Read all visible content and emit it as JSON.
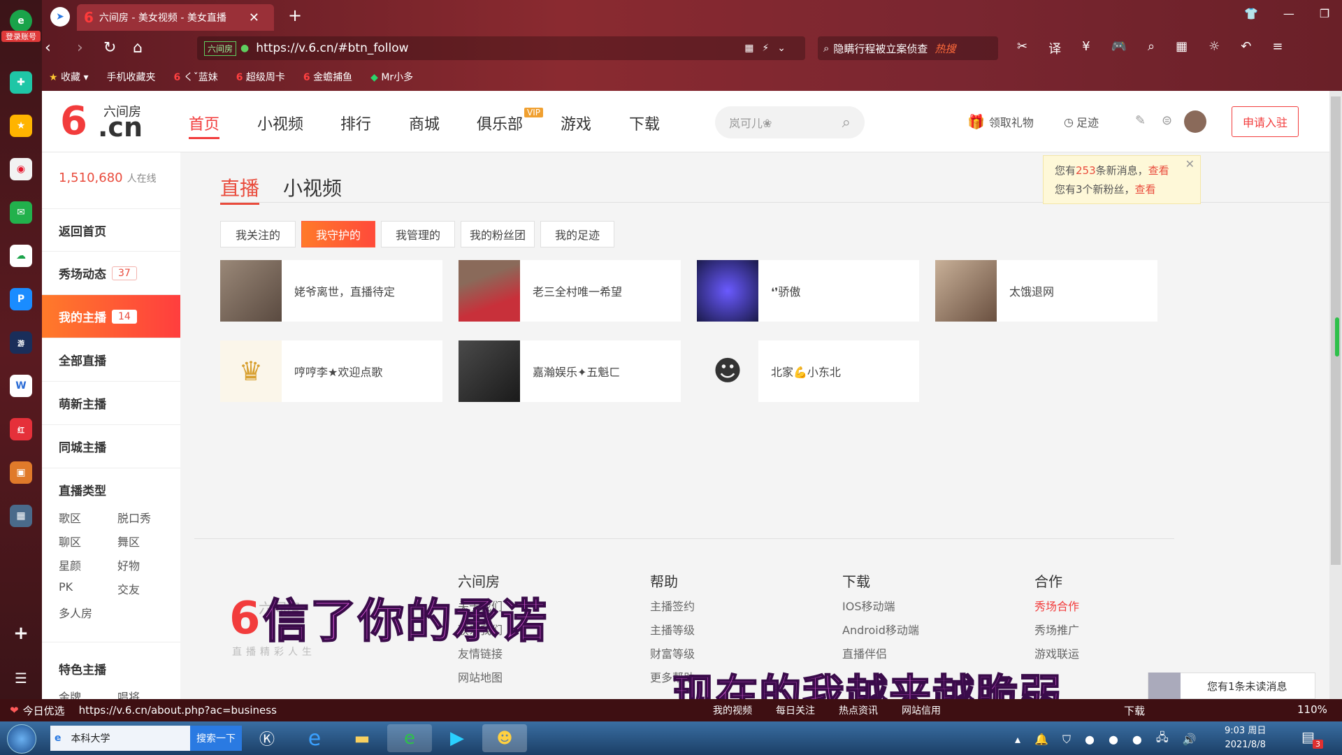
{
  "browser": {
    "side_label": "登录账号",
    "tab_title": "六间房 - 美女视频 - 美女直播",
    "url": "https://v.6.cn/#btn_follow",
    "url_badge": "六间房",
    "search_text": "隐瞒行程被立案侦查",
    "search_hot": "热搜",
    "bookmarks": [
      "收藏",
      "手机收藏夹",
      "くˇ蓝妹",
      "超级周卡",
      "金蟾捕鱼",
      "Mr小多"
    ]
  },
  "site": {
    "logo_text": "六间房",
    "logo_cn": ".cn",
    "nav": [
      "首页",
      "小视频",
      "排行",
      "商城",
      "俱乐部",
      "游戏",
      "下载"
    ],
    "vip_badge": "VIP",
    "search_placeholder": "岚可儿❀",
    "gift": "领取礼物",
    "footprint": "足迹",
    "apply": "申请入驻"
  },
  "sidebar": {
    "online_count": "1,510,680",
    "online_label": "人在线",
    "items": [
      {
        "label": "返回首页"
      },
      {
        "label": "秀场动态",
        "count": "37"
      },
      {
        "label": "我的主播",
        "count": "14"
      },
      {
        "label": "全部直播"
      },
      {
        "label": "萌新主播"
      },
      {
        "label": "同城主播"
      }
    ],
    "type_title": "直播类型",
    "types": [
      "歌区",
      "脱口秀",
      "聊区",
      "舞区",
      "星颜",
      "好物",
      "PK",
      "交友",
      "多人房"
    ],
    "feature_title": "特色主播",
    "feature_items": [
      "金牌",
      "唱将"
    ]
  },
  "main": {
    "tabs": [
      "直播",
      "小视频"
    ],
    "filters": [
      "我关注的",
      "我守护的",
      "我管理的",
      "我的粉丝团",
      "我的足迹"
    ],
    "notice": {
      "line1_pre": "您有",
      "line1_num": "253",
      "line1_post": "条新消息，",
      "line2": "您有3个新粉丝，",
      "link": "查看"
    },
    "anchors": [
      {
        "name": "姥爷离世，直播待定",
        "color": "#7a6a5c"
      },
      {
        "name": "老三全村唯一希望",
        "color": "#b8483e"
      },
      {
        "name": "❛❜骄傲",
        "color": "#2a2a6a"
      },
      {
        "name": "太饿退网",
        "color": "#8a7060"
      },
      {
        "name": "哼哼李★欢迎点歌",
        "color": "#f6efe0"
      },
      {
        "name": "嘉瀚娱乐✦五魁ㄈ",
        "color": "#2e2e2e"
      },
      {
        "name": "北家💪小东北",
        "color": "#f4f4f4"
      }
    ]
  },
  "footer": {
    "cols": [
      {
        "title": "六间房",
        "links": [
          "关于我们",
          "联系我们",
          "友情链接",
          "网站地图"
        ]
      },
      {
        "title": "帮助",
        "links": [
          "主播签约",
          "主播等级",
          "财富等级",
          "更多帮助"
        ]
      },
      {
        "title": "下载",
        "links": [
          "IOS移动端",
          "Android移动端",
          "直播伴侣"
        ]
      },
      {
        "title": "合作",
        "links": [
          "秀场合作",
          "秀场推广",
          "游戏联运"
        ]
      }
    ],
    "logo_text": "六间房",
    "slogan": "直播精彩人生"
  },
  "overlay": {
    "lyric1": "信了你的承诺",
    "lyric2": "现在的我越来越脆弱",
    "unread": "您有1条未读消息"
  },
  "statusbar": {
    "left": "今日优选",
    "url": "https://v.6.cn/about.php?ac=business",
    "items": [
      "我的视频",
      "每日关注",
      "热点资讯",
      "网站信用"
    ],
    "download": "下载",
    "zoom": "110%"
  },
  "taskbar": {
    "task_label": "本科大学",
    "search_btn": "搜索一下",
    "time": "9:03 周日",
    "date": "2021/8/8",
    "notif_count": "3"
  }
}
